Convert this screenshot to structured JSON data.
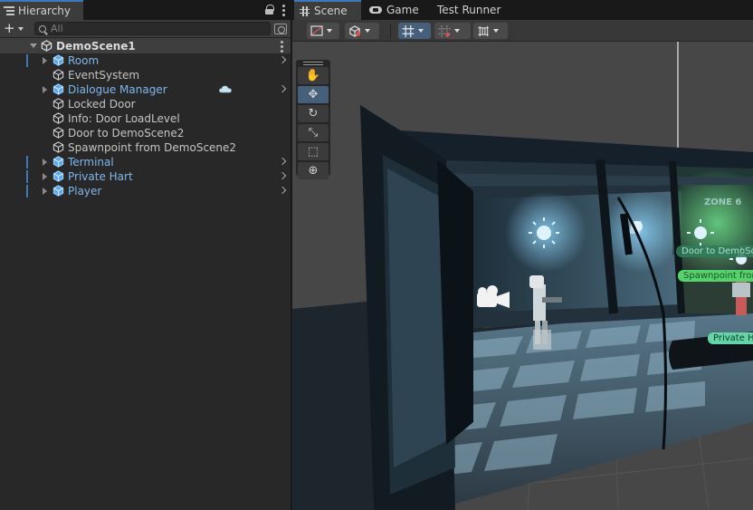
{
  "hierarchy": {
    "title": "Hierarchy",
    "search_placeholder": "All",
    "scene_name": "DemoScene1",
    "items": [
      {
        "label": "Room",
        "prefab": true,
        "expandable": true,
        "has_arrow": true,
        "marker": true
      },
      {
        "label": "EventSystem",
        "prefab": false,
        "expandable": false,
        "has_arrow": false,
        "marker": false
      },
      {
        "label": "Dialogue Manager",
        "prefab": true,
        "expandable": true,
        "has_arrow": true,
        "marker": false
      },
      {
        "label": "Locked Door",
        "prefab": false,
        "expandable": false,
        "has_arrow": false,
        "marker": false
      },
      {
        "label": "Info: Door LoadLevel",
        "prefab": false,
        "expandable": false,
        "has_arrow": false,
        "marker": false
      },
      {
        "label": "Door to DemoScene2",
        "prefab": false,
        "expandable": false,
        "has_arrow": false,
        "marker": false
      },
      {
        "label": "Spawnpoint from DemoScene2",
        "prefab": false,
        "expandable": false,
        "has_arrow": false,
        "marker": false
      },
      {
        "label": "Terminal",
        "prefab": true,
        "expandable": true,
        "has_arrow": true,
        "marker": true
      },
      {
        "label": "Private Hart",
        "prefab": true,
        "expandable": true,
        "has_arrow": true,
        "marker": true
      },
      {
        "label": "Player",
        "prefab": true,
        "expandable": true,
        "has_arrow": true,
        "marker": true
      }
    ]
  },
  "scene_view": {
    "tabs": [
      {
        "label": "Scene",
        "icon": "grid-icon",
        "active": true
      },
      {
        "label": "Game",
        "icon": "gamepad-icon",
        "active": false
      },
      {
        "label": "Test Runner",
        "icon": "",
        "active": false
      }
    ],
    "tools": [
      {
        "name": "hand-tool",
        "icon": "✋",
        "active": false
      },
      {
        "name": "move-tool",
        "icon": "✥",
        "active": true
      },
      {
        "name": "rotate-tool",
        "icon": "↻",
        "active": false
      },
      {
        "name": "scale-tool",
        "icon": "⤡",
        "active": false
      },
      {
        "name": "rect-tool",
        "icon": "⬚",
        "active": false
      },
      {
        "name": "transform-tool",
        "icon": "⊕",
        "active": false
      }
    ],
    "scene_labels": [
      {
        "text": "Door to DemoSc"
      },
      {
        "text": "Spawnpoint from De"
      },
      {
        "text": "Private H"
      }
    ],
    "wall_sign": "ZONE 6"
  },
  "colors": {
    "accent": "#3a79bb",
    "prefab_text": "#7bb8f0",
    "label_green": "#5bd6a5"
  }
}
